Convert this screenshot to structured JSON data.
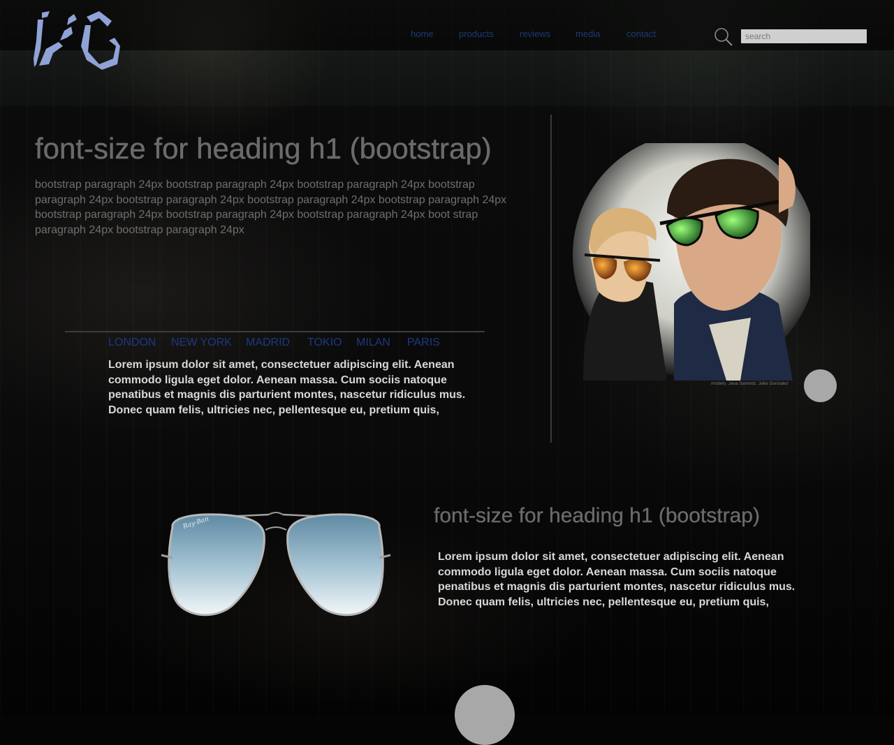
{
  "nav": {
    "items": [
      {
        "label": "home"
      },
      {
        "label": "products"
      },
      {
        "label": "reviews"
      },
      {
        "label": "media"
      },
      {
        "label": "contact"
      }
    ]
  },
  "search": {
    "placeholder": "search",
    "value": ""
  },
  "hero": {
    "title": "font-size for heading h1 (bootstrap)",
    "paragraph": "bootstrap paragraph 24px bootstrap paragraph 24px bootstrap paragraph 24px bootstrap paragraph 24px bootstrap paragraph 24px bootstrap paragraph 24px bootstrap paragraph 24px bootstrap paragraph 24px bootstrap paragraph 24px bootstrap paragraph 24px boot strap paragraph 24px bootstrap paragraph 24px"
  },
  "cities": [
    "LONDON",
    "NEW YORK",
    "MADRID",
    "TOKIO",
    "MILAN",
    "PARIS"
  ],
  "intro_text": "Lorem ipsum dolor sit amet, consectetuer adipiscing elit. Aenean commodo ligula eget dolor. Aenean massa. Cum sociis natoque penatibus et magnis dis parturient montes, nascetur ridiculus mus. Donec quam felis, ultricies nec, pellentesque eu, pretium quis,",
  "photo": {
    "credit": "models: Jana Sammtz, Jake Gonzalez"
  },
  "section2": {
    "title": "font-size for heading h1 (bootstrap)",
    "text": "Lorem ipsum dolor sit amet, consectetuer adipiscing elit. Aenean commodo ligula eget dolor. Aenean massa. Cum sociis natoque penatibus et magnis dis parturient montes, nascetur ridiculus mus. Donec quam felis, ultricies nec, pellentesque eu, pretium quis,"
  },
  "colors": {
    "logo": "#8fa3d6",
    "nav_link": "#1e3a7a",
    "city_link": "#1b3a82",
    "heading": "#6b6b6b",
    "body_text": "#d8d8d8",
    "circle": "#a8a8a8"
  }
}
